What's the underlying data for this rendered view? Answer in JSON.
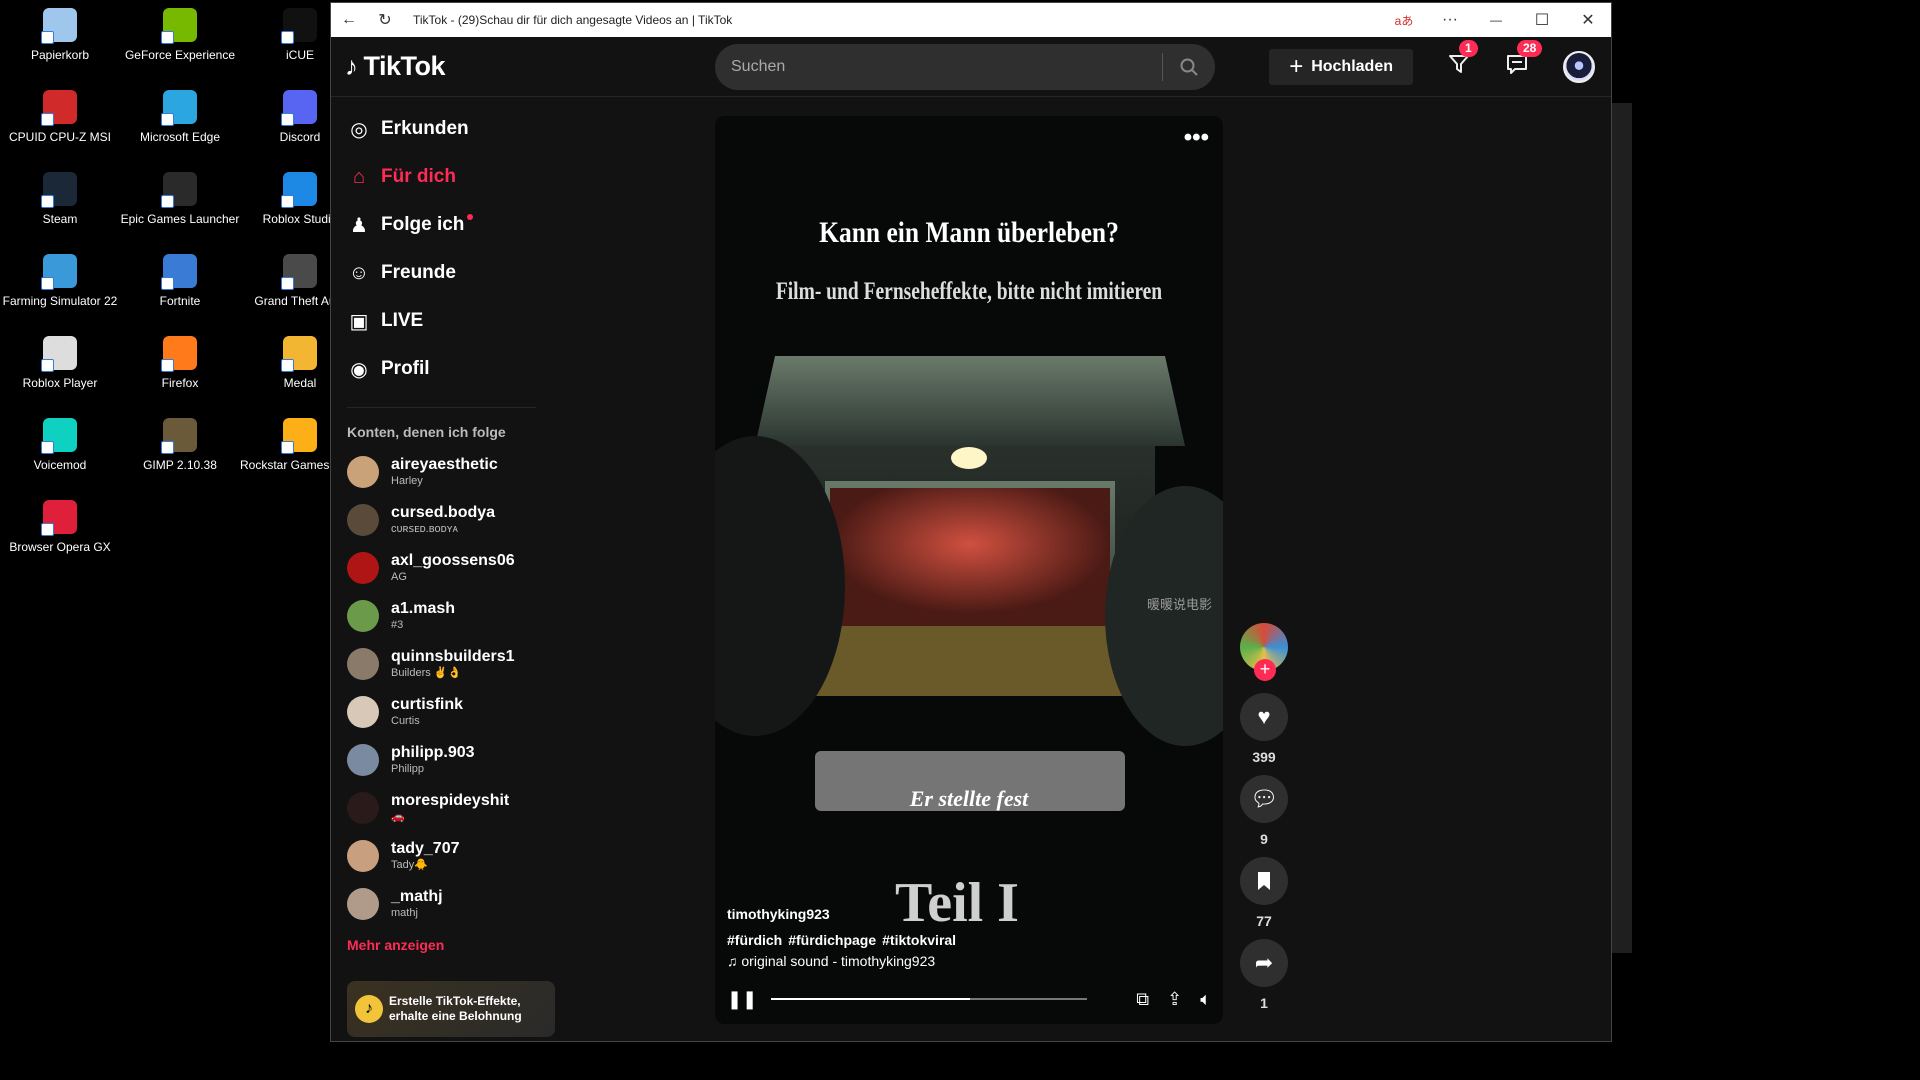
{
  "desktop": {
    "icons": [
      {
        "label": "Papierkorb",
        "color": "#9fc7ee"
      },
      {
        "label": "GeForce Experience",
        "color": "#76b900"
      },
      {
        "label": "iCUE",
        "color": "#111111"
      },
      {
        "label": "CPUID CPU-Z MSI",
        "color": "#d12a2a"
      },
      {
        "label": "Microsoft Edge",
        "color": "#2ca6e0"
      },
      {
        "label": "Discord",
        "color": "#5865f2"
      },
      {
        "label": "Steam",
        "color": "#1b2838"
      },
      {
        "label": "Epic Games Launcher",
        "color": "#2a2a2a"
      },
      {
        "label": "Roblox Studio",
        "color": "#1e88e5"
      },
      {
        "label": "Farming Simulator 22",
        "color": "#3a9ad9"
      },
      {
        "label": "Fortnite",
        "color": "#3a7bd5"
      },
      {
        "label": "Grand Theft Auto",
        "color": "#4a4a4a"
      },
      {
        "label": "Roblox Player",
        "color": "#dddddd"
      },
      {
        "label": "Firefox",
        "color": "#ff7a1a"
      },
      {
        "label": "Medal",
        "color": "#f2b632"
      },
      {
        "label": "Voicemod",
        "color": "#0fd1c2"
      },
      {
        "label": "GIMP 2.10.38",
        "color": "#6b5a3a"
      },
      {
        "label": "Rockstar Games Launcher",
        "color": "#fcaf17"
      },
      {
        "label": "Browser Opera GX",
        "color": "#e0203b"
      }
    ]
  },
  "browser": {
    "title": "TikTok - (29)Schau dir für dich angesagte Videos an | TikTok",
    "read_aloud": "aあ",
    "menu": "···",
    "minimize": "—",
    "maximize": "☐",
    "close": "✕"
  },
  "header": {
    "logo": "TikTok",
    "search_placeholder": "Suchen",
    "upload_label": "Hochladen",
    "inbox_badge": "1",
    "messages_badge": "28"
  },
  "nav": [
    {
      "label": "Erkunden",
      "icon": "compass-icon",
      "glyph": "◎"
    },
    {
      "label": "Für dich",
      "icon": "home-icon",
      "glyph": "⌂",
      "active": true
    },
    {
      "label": "Folge ich",
      "icon": "following-icon",
      "glyph": "♟"
    },
    {
      "label": "Freunde",
      "icon": "friends-icon",
      "glyph": "☺"
    },
    {
      "label": "LIVE",
      "icon": "live-icon",
      "glyph": "▣"
    },
    {
      "label": "Profil",
      "icon": "profile-icon",
      "glyph": "◉"
    }
  ],
  "following_header": "Konten, denen ich folge",
  "accounts": [
    {
      "username": "aireyaesthetic",
      "display": "Harley",
      "color": "#c9a27a"
    },
    {
      "username": "cursed.bodya",
      "display": "ᴄᴜʀꜱᴇᴅ.ʙᴏᴅʏᴀ",
      "color": "#5a4a3a"
    },
    {
      "username": "axl_goossens06",
      "display": "AG",
      "color": "#b01515"
    },
    {
      "username": "a1.mash",
      "display": "#3",
      "color": "#6a9a4a"
    },
    {
      "username": "quinnsbuilders1",
      "display": "Builders ✌️👌",
      "color": "#8a7a6a"
    },
    {
      "username": "curtisfink",
      "display": "Curtis",
      "color": "#d8c8b8"
    },
    {
      "username": "philipp.903",
      "display": "Philipp",
      "color": "#7a8aa0"
    },
    {
      "username": "morespideyshit",
      "display": "🚗",
      "color": "#2a1a1a"
    },
    {
      "username": "tady_707",
      "display": "Tady🐥",
      "color": "#c8a080"
    },
    {
      "username": "_mathj",
      "display": "mathj",
      "color": "#b09a8a"
    }
  ],
  "more_label": "Mehr anzeigen",
  "promo_text": "Erstelle TikTok-Effekte, erhalte eine Belohnung",
  "video": {
    "title": "Kann ein Mann überleben?",
    "subtitle": "Film- und Fernseheffekte, bitte nicht imitieren",
    "caption": "Er stellte fest",
    "part": "Teil I",
    "watermark": "暖暖说电影",
    "author": "timothyking923",
    "tags": [
      "#fürdich",
      "#fürdichpage",
      "#tiktokviral"
    ],
    "sound": "original sound - timothyking923",
    "progress": 0.63
  },
  "actions": {
    "likes": "399",
    "comments": "9",
    "saves": "77",
    "shares": "1"
  }
}
